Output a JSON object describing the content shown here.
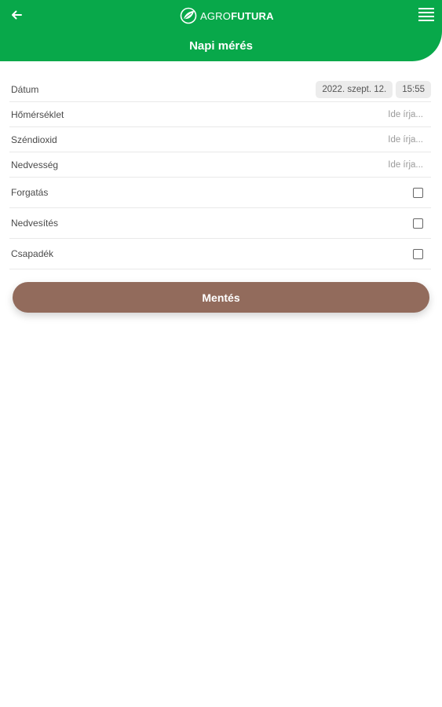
{
  "colors": {
    "header_bg": "#08a84a",
    "save_button_bg": "#926b5c"
  },
  "header": {
    "back_icon": "arrow-left-icon",
    "logo_light": "AGRO",
    "logo_bold": "FUTURA",
    "menu_icon": "hamburger-menu-icon",
    "title": "Napi mérés"
  },
  "form": {
    "date": {
      "label": "Dátum",
      "date_value": "2022. szept. 12.",
      "time_value": "15:55"
    },
    "temperature": {
      "label": "Hőmérséklet",
      "placeholder": "Ide írja..."
    },
    "co2": {
      "label": "Széndioxid",
      "placeholder": "Ide írja..."
    },
    "humidity": {
      "label": "Nedvesség",
      "placeholder": "Ide írja..."
    },
    "rotation": {
      "label": "Forgatás",
      "checked": false
    },
    "wetting": {
      "label": "Nedvesítés",
      "checked": false
    },
    "precipitation": {
      "label": "Csapadék",
      "checked": false
    }
  },
  "save_button": {
    "label": "Mentés"
  }
}
